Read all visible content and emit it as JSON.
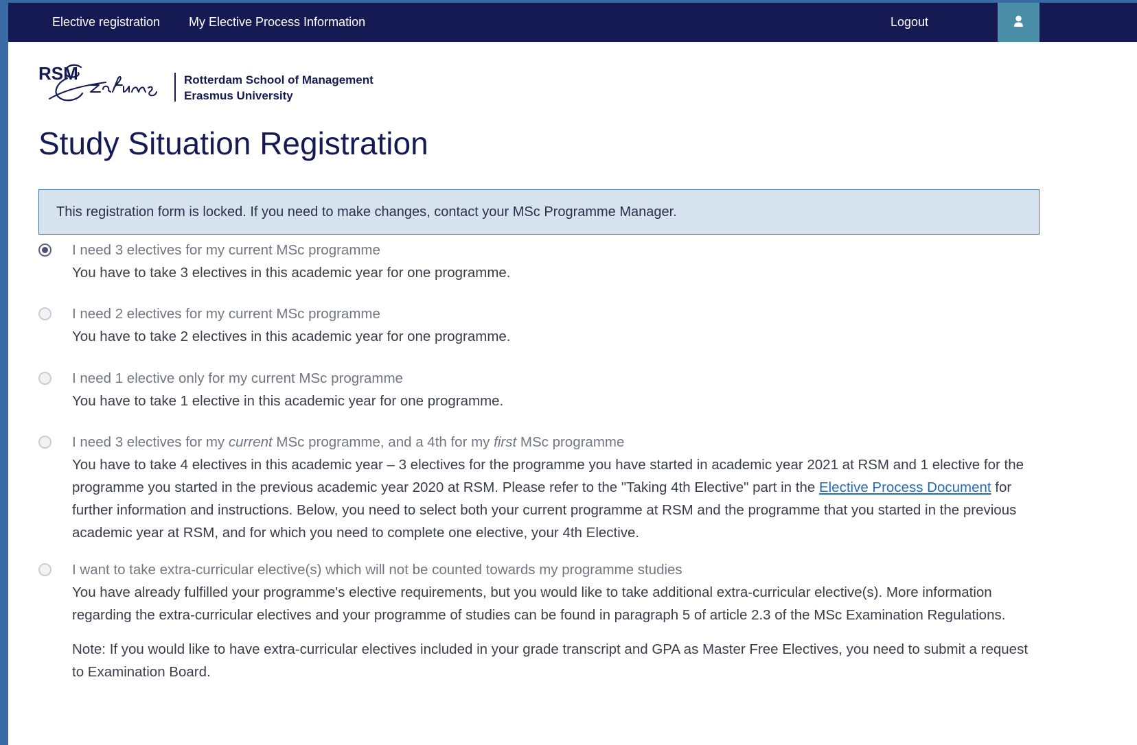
{
  "nav": {
    "elective_registration": "Elective registration",
    "my_elective_info": "My Elective Process Information",
    "logout": "Logout",
    "user_icon": "user-icon"
  },
  "logo": {
    "rsm": "RSM",
    "line1": "Rotterdam School of Management",
    "line2": "Erasmus University"
  },
  "page_title": "Study Situation Registration",
  "alert": "This registration form is locked. If you need to make changes, contact your MSc Programme Manager.",
  "options": [
    {
      "label": "I need 3 electives for my current MSc programme",
      "desc": "You have to take 3 electives in this academic year for one programme.",
      "checked": true
    },
    {
      "label": "I need 2 electives for my current MSc programme",
      "desc": "You have to take 2 electives in this academic year for one programme.",
      "checked": false
    },
    {
      "label": "I need 1 elective only for my current MSc programme",
      "desc": "You have to take 1 elective in this academic year for one programme.",
      "checked": false
    },
    {
      "label_part1": "I need 3 electives for my ",
      "label_em1": "current",
      "label_part2": " MSc programme, and a 4th for my ",
      "label_em2": "first",
      "label_part3": " MSc programme",
      "desc_part1": "You have to take 4 electives in this academic year – 3 electives for the programme you have started in academic year 2021 at RSM and 1 elective for the programme you started in the previous academic year 2020 at RSM. Please refer to the \"Taking 4th Elective\" part in the ",
      "desc_link": "Elective Process Document",
      "desc_part2": " for further information and instructions. Below, you need to select both your current programme at RSM and the programme that you started in the previous academic year at RSM, and for which you need to complete one elective, your 4th Elective.",
      "checked": false
    },
    {
      "label": "I want to take extra-curricular elective(s) which will not be counted towards my programme studies",
      "desc": "You have already fulfilled your programme's elective requirements, but you would like to take additional extra-curricular elective(s). More information regarding the extra-curricular electives and your programme of studies can be found in paragraph 5 of article 2.3 of the MSc Examination Regulations.",
      "note": "Note: If you would like to have extra-curricular electives included in your grade transcript and GPA as Master Free Electives, you need to submit a request to Examination Board.",
      "checked": false
    }
  ]
}
